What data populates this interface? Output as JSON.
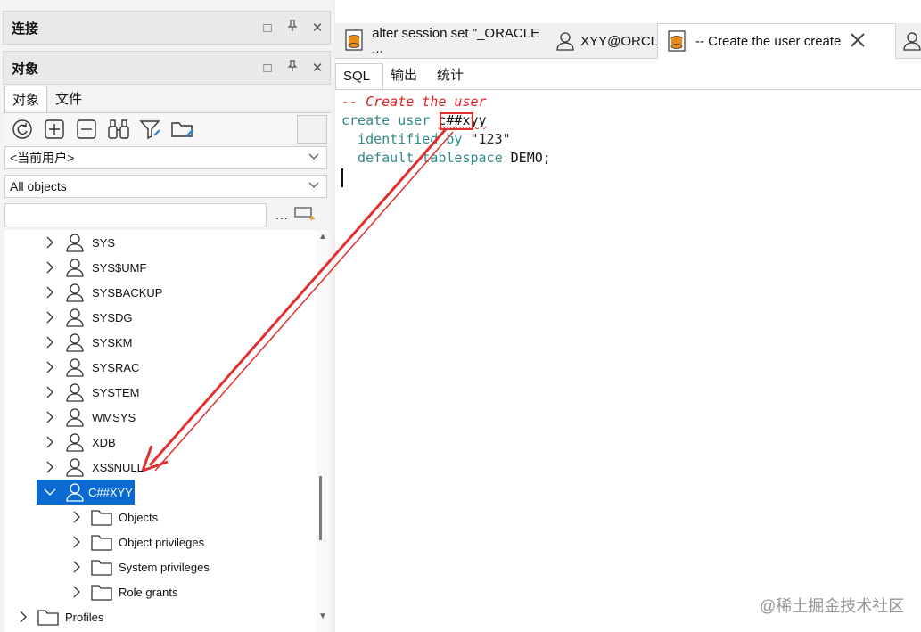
{
  "top_strip": {},
  "connection_panel": {
    "title": "连接"
  },
  "objects_panel": {
    "title": "对象",
    "tabs": [
      {
        "label": "对象"
      },
      {
        "label": "文件"
      }
    ],
    "user_select": "<当前用户>",
    "type_select": "All objects",
    "filter_value": "",
    "more_label": "..."
  },
  "tree": {
    "users": [
      {
        "label": "SYS"
      },
      {
        "label": "SYS$UMF"
      },
      {
        "label": "SYSBACKUP"
      },
      {
        "label": "SYSDG"
      },
      {
        "label": "SYSKM"
      },
      {
        "label": "SYSRAC"
      },
      {
        "label": "SYSTEM"
      },
      {
        "label": "WMSYS"
      },
      {
        "label": "XDB"
      },
      {
        "label": "XS$NULL"
      }
    ],
    "selected_user": {
      "label": "C##XYY"
    },
    "children": [
      {
        "label": "Objects"
      },
      {
        "label": "Object privileges"
      },
      {
        "label": "System privileges"
      },
      {
        "label": "Role grants"
      }
    ],
    "profiles": {
      "label": "Profiles"
    }
  },
  "doc_tabs": [
    {
      "label": "alter session set \"_ORACLE ..."
    },
    {
      "label": "XYY@ORCL"
    },
    {
      "label": "-- Create the user create"
    }
  ],
  "sub_tabs": [
    {
      "label": "SQL"
    },
    {
      "label": "输出"
    },
    {
      "label": "统计"
    }
  ],
  "editor": {
    "line1": "-- Create the user",
    "line2_kw": "create user ",
    "line2_id": "c##xyy",
    "line3_kw1": "  identified by ",
    "line3_str": "\"123\"",
    "line4_kw": "  default tablespace ",
    "line4_val": "DEMO;"
  },
  "watermark": "@稀土掘金技术社区",
  "colors": {
    "selection": "#0a6ad1",
    "annotation": "#e03030",
    "keyword": "#2e8b8b",
    "comment": "#e02020"
  }
}
